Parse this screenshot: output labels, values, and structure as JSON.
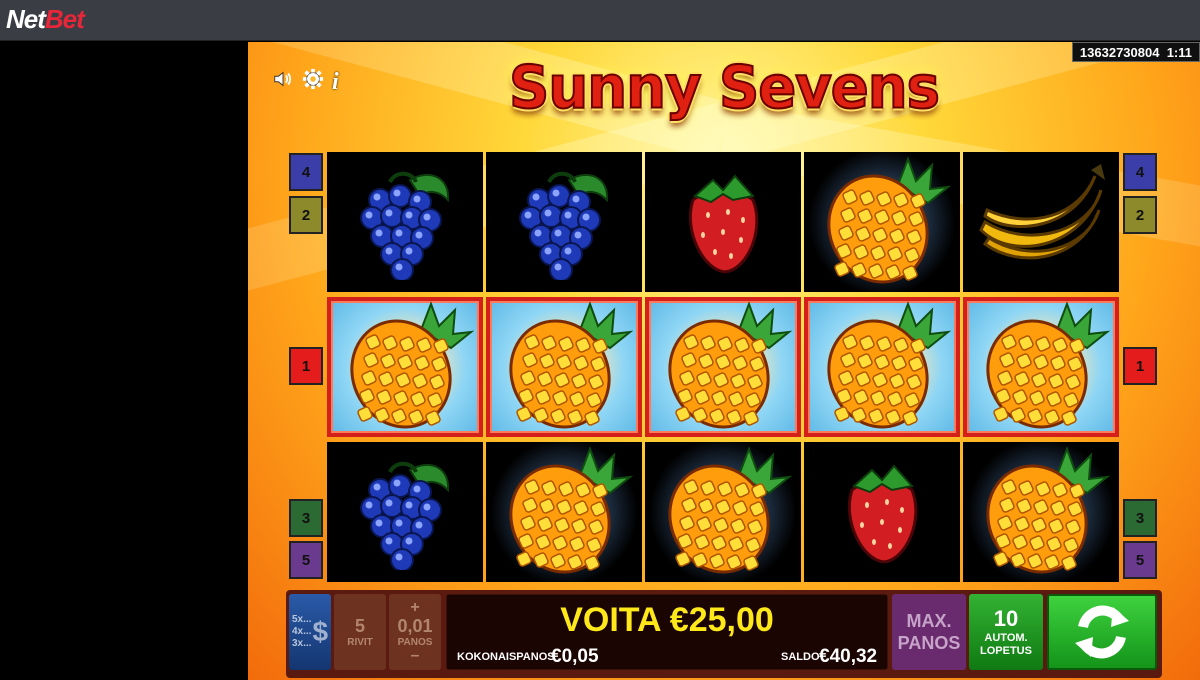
{
  "brand": {
    "part1": "Net",
    "part2": "Bet"
  },
  "session": {
    "id": "13632730804",
    "time": "1:11"
  },
  "game": {
    "title": "Sunny Sevens"
  },
  "icons": {
    "sound": "speaker-icon",
    "settings": "gear-icon",
    "info": "info-icon",
    "spin": "spin-arrows-icon"
  },
  "paylines": {
    "left": [
      {
        "label": "4",
        "color": "#3b3ea8"
      },
      {
        "label": "2",
        "color": "#8c8a2a"
      },
      {
        "label": "1",
        "color": "#e41c1c"
      },
      {
        "label": "3",
        "color": "#2c6a33"
      },
      {
        "label": "5",
        "color": "#6a3a8e"
      }
    ],
    "right": [
      {
        "label": "4",
        "color": "#3b3ea8"
      },
      {
        "label": "2",
        "color": "#8c8a2a"
      },
      {
        "label": "1",
        "color": "#e41c1c"
      },
      {
        "label": "3",
        "color": "#2c6a33"
      },
      {
        "label": "5",
        "color": "#6a3a8e"
      }
    ]
  },
  "reels": [
    [
      "grapes",
      "grapes",
      "strawberry",
      "pineapple",
      "banana"
    ],
    [
      "pineapple",
      "pineapple",
      "pineapple",
      "pineapple",
      "pineapple"
    ],
    [
      "grapes",
      "pineapple",
      "pineapple",
      "strawberry",
      "pineapple"
    ]
  ],
  "winning_row": 1,
  "controls": {
    "multipliers": [
      "5x...",
      "4x...",
      "3x..."
    ],
    "currency_symbol": "$",
    "lines": {
      "value": "5",
      "label": "RIVIT"
    },
    "bet": {
      "plus": "+",
      "value": "0,01",
      "label": "PANOS",
      "minus": "–"
    },
    "win": {
      "label": "VOITA",
      "amount": "€25,00"
    },
    "total_bet": {
      "label": "KOKONAISPANOS",
      "amount": "€0,05"
    },
    "balance": {
      "label": "SALDO",
      "amount": "€40,32"
    },
    "max_bet": {
      "line1": "MAX.",
      "line2": "PANOS"
    },
    "autoplay": {
      "value": "10",
      "line1": "AUTOM.",
      "line2": "LOPETUS"
    }
  },
  "colors": {
    "win_text": "#ffe81a",
    "win_frame": "#d4201a",
    "spin_green": "#2bc22b"
  }
}
